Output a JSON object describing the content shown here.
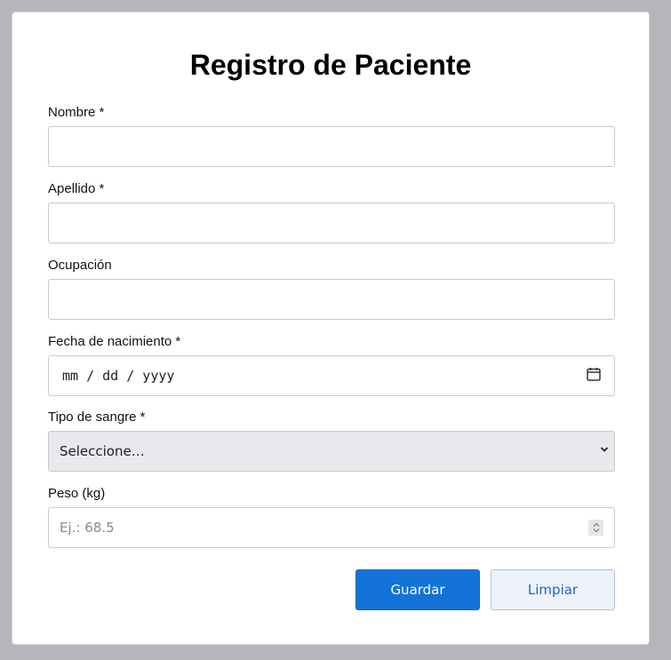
{
  "form": {
    "title": "Registro de Paciente",
    "fields": {
      "nombre": {
        "label": "Nombre *",
        "value": ""
      },
      "apellido": {
        "label": "Apellido *",
        "value": ""
      },
      "ocupacion": {
        "label": "Ocupación",
        "value": ""
      },
      "fecha": {
        "label": "Fecha de nacimiento *",
        "value_display": "mm / dd / yyyy",
        "icon": "calendar-icon"
      },
      "sangre": {
        "label": "Tipo de sangre *",
        "selected": "Seleccione…",
        "icon": "chevron-down-icon"
      },
      "peso": {
        "label": "Peso (kg)",
        "placeholder": "Ej.: 68.5",
        "icon": "spinner-icon"
      }
    },
    "buttons": {
      "save_label": "Guardar",
      "clear_label": "Limpiar"
    }
  },
  "colors": {
    "primary": "#1473d8",
    "secondary_bg": "#eef3fa",
    "secondary_text": "#1a66c7",
    "select_bg": "#e9e9ed",
    "page_bg": "#b6b6ba"
  }
}
